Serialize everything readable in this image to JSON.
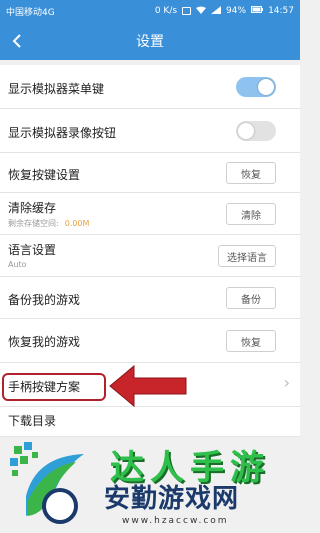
{
  "status_bar": {
    "carrier": "中国移动4G",
    "speed": "0 K/s",
    "battery": "94%",
    "time": "14:57"
  },
  "header": {
    "title": "设置"
  },
  "settings": {
    "show_menu_key": {
      "label": "显示模拟器菜单键",
      "enabled": true
    },
    "show_record_button": {
      "label": "显示模拟器录像按钮",
      "enabled": false
    },
    "restore_keys": {
      "label": "恢复按键设置",
      "button": "恢复"
    },
    "clear_cache": {
      "label": "清除缓存",
      "sub_label": "剩余存储空间:",
      "sub_value": "0.00M",
      "button": "清除"
    },
    "language": {
      "label": "语言设置",
      "sub_label": "Auto",
      "button": "选择语言"
    },
    "backup_games": {
      "label": "备份我的游戏",
      "button": "备份"
    },
    "restore_games": {
      "label": "恢复我的游戏",
      "button": "恢复"
    },
    "gamepad_scheme": {
      "label": "手柄按键方案"
    },
    "download_dir": {
      "label": "下载目录"
    }
  },
  "colors": {
    "header_bg": "#3a8fd9",
    "toggle_on": "#8ec3ef",
    "highlight": "#b0222a",
    "cache_value": "#e8a040"
  },
  "watermark": {
    "brand_top": "达人手游",
    "brand_main": "安勤游戏网",
    "url": "www.hzaccw.com"
  }
}
